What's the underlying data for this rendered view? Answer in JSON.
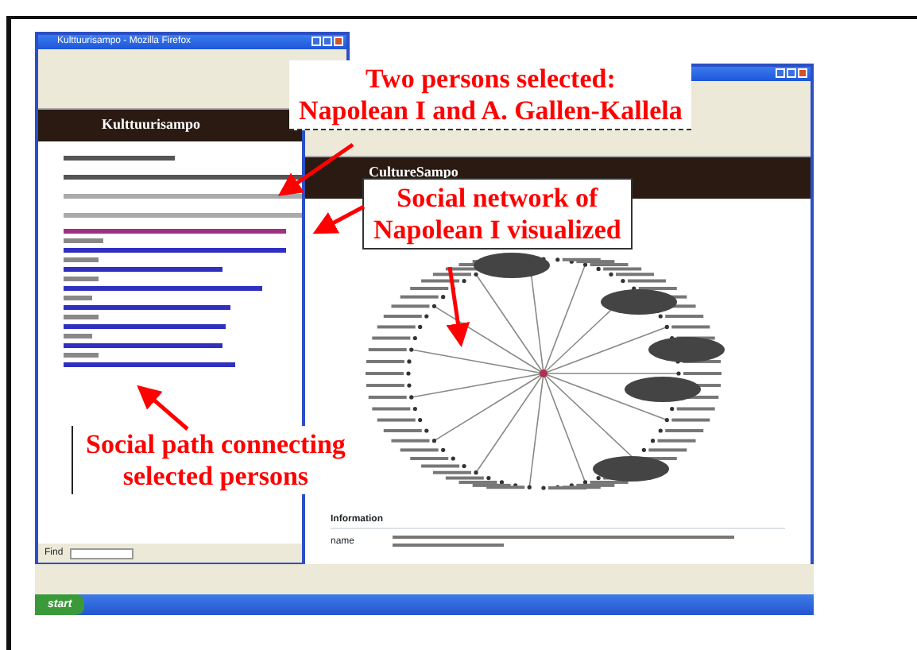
{
  "left_window": {
    "title": "Kulttuurisampo - Mozilla Firefox",
    "site_title": "Kulttuurisampo",
    "find_label": "Find"
  },
  "right_window": {
    "site_title": "CultureSampo",
    "info_heading": "Information",
    "info_label": "name"
  },
  "taskbar": {
    "start": "start"
  },
  "callouts": [
    {
      "kind": "boxed",
      "lines": [
        "Two persons selected:",
        "Napolean I and A. Gallen-Kallela"
      ]
    },
    {
      "kind": "framed",
      "lines": [
        "Social network of",
        "Napolean I visualized"
      ]
    },
    {
      "kind": "plain",
      "lines": [
        "Social path connecting",
        "selected persons"
      ]
    }
  ]
}
